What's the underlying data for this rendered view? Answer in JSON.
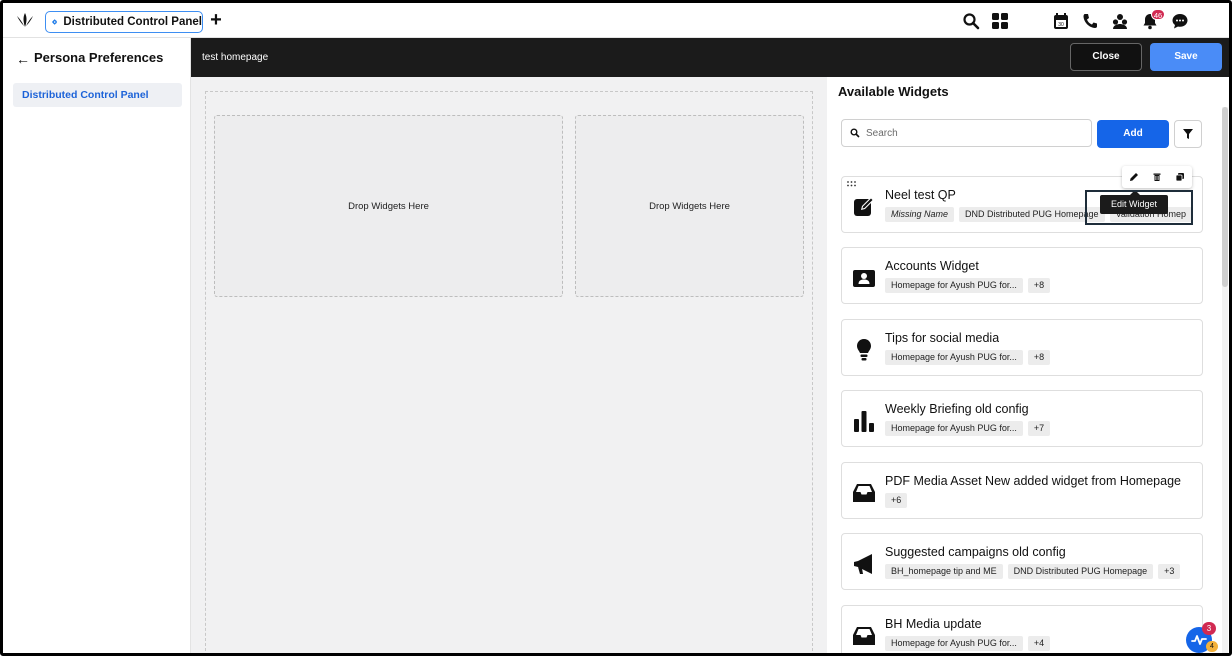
{
  "topbar": {
    "tab_label": "Distributed Control Panel",
    "notification_count": "46"
  },
  "sidebar": {
    "title": "Persona Preferences",
    "item_label": "Distributed Control Panel"
  },
  "editor": {
    "page_name": "test homepage",
    "close_label": "Close",
    "save_label": "Save",
    "drop_left": "Drop Widgets Here",
    "drop_right": "Drop Widgets Here"
  },
  "widgets": {
    "title": "Available Widgets",
    "search_placeholder": "Search",
    "add_label": "Add",
    "tooltip": "Edit Widget",
    "items": [
      {
        "title": "Neel test QP",
        "icon": "edit-square-icon",
        "chips": [
          "Missing Name",
          "DND Distributed PUG Homepage",
          "Validation Homep"
        ]
      },
      {
        "title": "Accounts Widget",
        "icon": "contact-card-icon",
        "chips": [
          "Homepage for Ayush PUG for...",
          "+8"
        ]
      },
      {
        "title": "Tips for social media",
        "icon": "lightbulb-icon",
        "chips": [
          "Homepage for Ayush PUG for...",
          "+8"
        ]
      },
      {
        "title": "Weekly Briefing old config",
        "icon": "bar-chart-icon",
        "chips": [
          "Homepage for Ayush PUG for...",
          "+7"
        ]
      },
      {
        "title": "PDF Media Asset New added widget from Homepage",
        "icon": "inbox-icon",
        "chips": [
          "+6"
        ]
      },
      {
        "title": "Suggested campaigns old config",
        "icon": "megaphone-icon",
        "chips": [
          "BH_homepage tip and ME",
          "DND Distributed PUG Homepage",
          "+3"
        ]
      },
      {
        "title": "BH Media update",
        "icon": "inbox-icon",
        "chips": [
          "Homepage for Ayush PUG for...",
          "+4"
        ]
      }
    ]
  },
  "activity": {
    "badge_count": "3",
    "secondary_count": "4"
  },
  "colors": {
    "primary": "#1565e8",
    "save": "#4a8cf7",
    "header": "#1b1b1b",
    "badge": "#d12a52"
  }
}
